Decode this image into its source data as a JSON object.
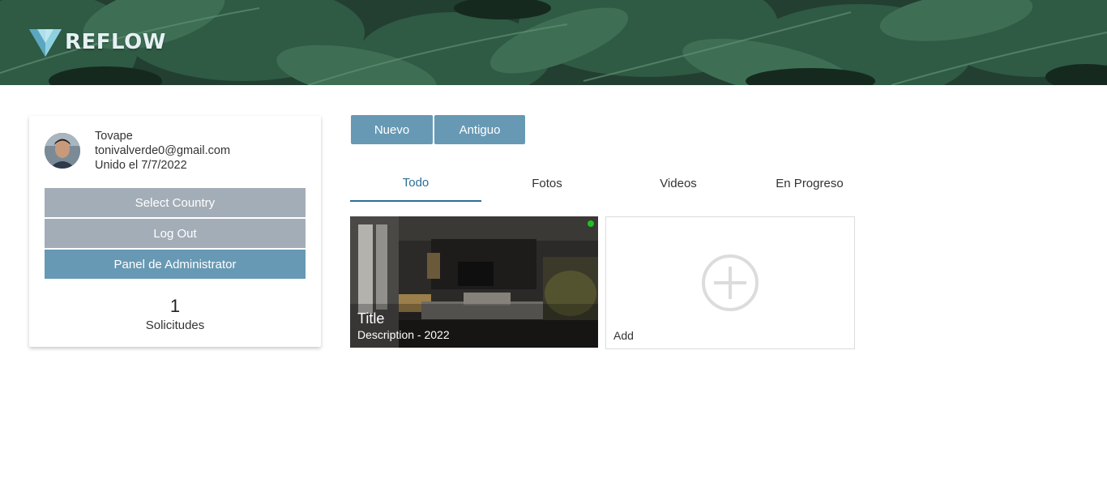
{
  "header": {
    "brand": "REFLOW",
    "background": "tropical-leaves-image"
  },
  "profile": {
    "username": "Tovape",
    "email": "tonivalverde0@gmail.com",
    "joined": "Unido el 7/7/2022",
    "buttons": {
      "select_country": "Select Country",
      "log_out": "Log Out",
      "admin_panel": "Panel de Administrator"
    },
    "requests": {
      "count": "1",
      "label": "Solicitudes"
    }
  },
  "sort": {
    "new_label": "Nuevo",
    "old_label": "Antiguo"
  },
  "tabs": [
    {
      "label": "Todo",
      "active": true
    },
    {
      "label": "Fotos",
      "active": false
    },
    {
      "label": "Videos",
      "active": false
    },
    {
      "label": "En Progreso",
      "active": false
    }
  ],
  "projects": [
    {
      "title": "Title",
      "description": "Description - 2022",
      "status_color": "#1ec21e",
      "image": "dark-living-room-interior"
    }
  ],
  "add_card": {
    "label": "Add",
    "icon": "plus-circle-icon"
  },
  "colors": {
    "primary": "#6799b4",
    "secondary": "#a3adb7",
    "tab_active": "#2c6e98"
  }
}
